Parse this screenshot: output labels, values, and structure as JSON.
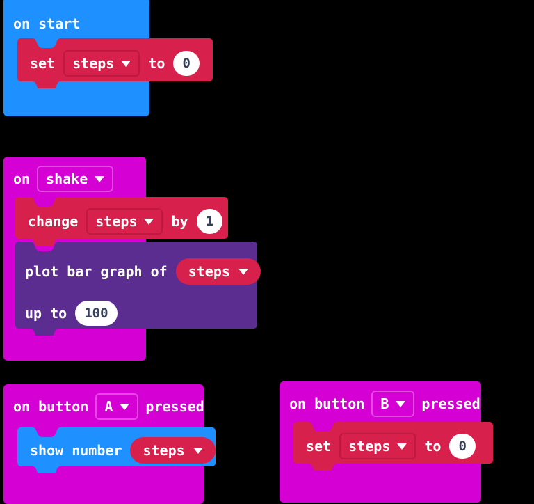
{
  "workspace": {
    "background_color": "#000000",
    "editor": "MakeCode micro:bit block editor"
  },
  "colors": {
    "event_blue": "#1e90ff",
    "event_magenta": "#d400d4",
    "variables_red": "#d7204b",
    "led_purple": "#5c2d91",
    "basic_blue": "#1e90ff",
    "field_white": "#ffffff",
    "number_text": "#36405a"
  },
  "scripts": [
    {
      "id": "on-start",
      "hat_label": "on start",
      "hat_color": "#1e90ff",
      "statements": [
        {
          "id": "set-steps-to-0",
          "color": "#d7204b",
          "parts": [
            {
              "type": "label",
              "text": "set"
            },
            {
              "type": "dropdown",
              "text": "steps"
            },
            {
              "type": "label",
              "text": "to"
            },
            {
              "type": "number",
              "text": "0"
            }
          ]
        }
      ]
    },
    {
      "id": "on-shake",
      "hat_prefix": "on",
      "hat_dropdown": "shake",
      "hat_color": "#d400d4",
      "statements": [
        {
          "id": "change-steps-by-1",
          "color": "#d7204b",
          "parts": [
            {
              "type": "label",
              "text": "change"
            },
            {
              "type": "dropdown",
              "text": "steps"
            },
            {
              "type": "label",
              "text": "by"
            },
            {
              "type": "number",
              "text": "1"
            }
          ]
        },
        {
          "id": "plot-bar-graph",
          "color": "#5c2d91",
          "line1": [
            {
              "type": "label",
              "text": "plot bar graph of"
            },
            {
              "type": "reporter",
              "text": "steps"
            }
          ],
          "line2": [
            {
              "type": "label",
              "text": "up to"
            },
            {
              "type": "number",
              "text": "100"
            }
          ]
        }
      ]
    },
    {
      "id": "on-button-a-pressed",
      "hat_prefix": "on button",
      "hat_dropdown": "A",
      "hat_suffix": "pressed",
      "hat_color": "#d400d4",
      "statements": [
        {
          "id": "show-number-steps",
          "color": "#1e90ff",
          "parts": [
            {
              "type": "label",
              "text": "show number"
            },
            {
              "type": "reporter",
              "text": "steps"
            }
          ]
        }
      ]
    },
    {
      "id": "on-button-b-pressed",
      "hat_prefix": "on button",
      "hat_dropdown": "B",
      "hat_suffix": "pressed",
      "hat_color": "#d400d4",
      "statements": [
        {
          "id": "set-steps-to-0-b",
          "color": "#d7204b",
          "parts": [
            {
              "type": "label",
              "text": "set"
            },
            {
              "type": "dropdown",
              "text": "steps"
            },
            {
              "type": "label",
              "text": "to"
            },
            {
              "type": "number",
              "text": "0"
            }
          ]
        }
      ]
    }
  ]
}
